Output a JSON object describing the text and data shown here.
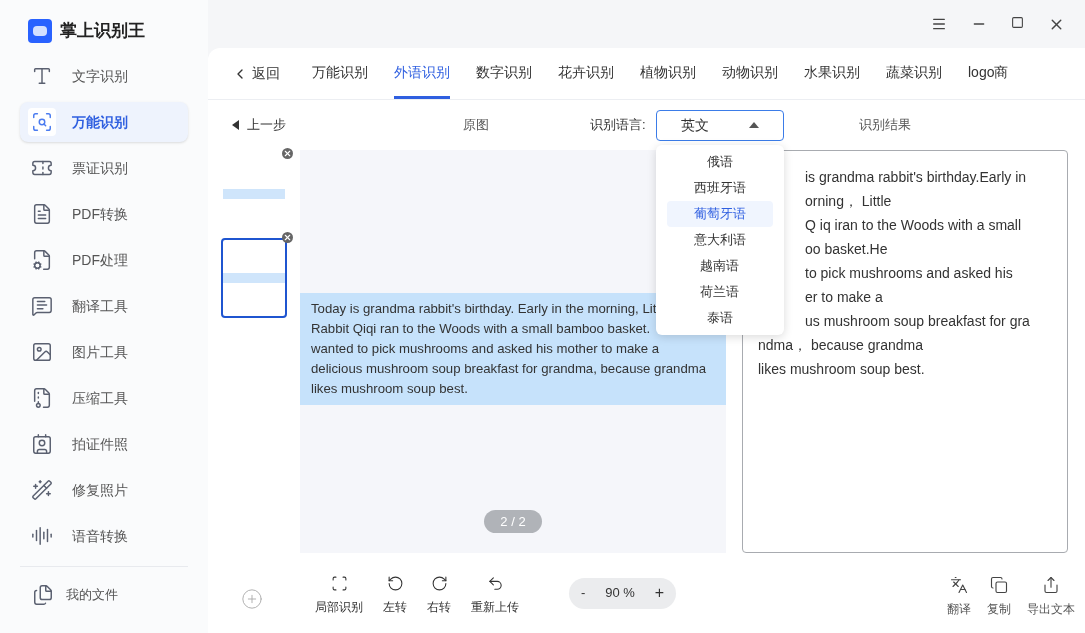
{
  "app": {
    "title": "掌上识别王"
  },
  "sidebar": {
    "items": [
      {
        "label": "文字识别",
        "selected": false,
        "kind": "text"
      },
      {
        "label": "万能识别",
        "selected": true,
        "kind": "scan"
      },
      {
        "label": "票证识别",
        "selected": false,
        "kind": "ticket"
      },
      {
        "label": "PDF转换",
        "selected": false,
        "kind": "pdf"
      },
      {
        "label": "PDF处理",
        "selected": false,
        "kind": "pdfedit"
      },
      {
        "label": "翻译工具",
        "selected": false,
        "kind": "translate"
      },
      {
        "label": "图片工具",
        "selected": false,
        "kind": "image"
      },
      {
        "label": "压缩工具",
        "selected": false,
        "kind": "compress"
      },
      {
        "label": "拍证件照",
        "selected": false,
        "kind": "idphoto"
      },
      {
        "label": "修复照片",
        "selected": false,
        "kind": "repair"
      },
      {
        "label": "语音转换",
        "selected": false,
        "kind": "voice"
      }
    ],
    "footer": "我的文件"
  },
  "tabs": {
    "back": "返回",
    "items": [
      {
        "label": "万能识别",
        "selected": false
      },
      {
        "label": "外语识别",
        "selected": true
      },
      {
        "label": "数字识别",
        "selected": false
      },
      {
        "label": "花卉识别",
        "selected": false
      },
      {
        "label": "植物识别",
        "selected": false
      },
      {
        "label": "动物识别",
        "selected": false
      },
      {
        "label": "水果识别",
        "selected": false
      },
      {
        "label": "蔬菜识别",
        "selected": false
      },
      {
        "label": "logo商",
        "selected": false
      }
    ]
  },
  "toolbar": {
    "prev_step": "上一步",
    "original_label": "原图",
    "language_label": "识别语言:",
    "language_value": "英文",
    "result_label": "识别结果"
  },
  "language_menu": {
    "expanded": true,
    "items": [
      {
        "label": "俄语",
        "selected": false
      },
      {
        "label": "西班牙语",
        "selected": false
      },
      {
        "label": "葡萄牙语",
        "selected": true
      },
      {
        "label": "意大利语",
        "selected": false
      },
      {
        "label": "越南语",
        "selected": false
      },
      {
        "label": "荷兰语",
        "selected": false
      },
      {
        "label": "泰语",
        "selected": false
      }
    ]
  },
  "thumbnails": [
    {
      "selected": false
    },
    {
      "selected": true
    }
  ],
  "image": {
    "lines": [
      "Today is grandma rabbit's birthday. Early in the morning, Lit",
      "Rabbit Qiqi ran to the Woods with a small bamboo basket.",
      "wanted to pick mushrooms and asked his mother to make a",
      "delicious mushroom soup breakfast for grandma, because grandma",
      "likes mushroom soup best."
    ],
    "page": "2 / 2"
  },
  "result": {
    "partly_hidden_lines": [
      "is grandma rabbit's birthday.Early in",
      "orning，  Little",
      "Q iq iran to the Woods with a small",
      "oo basket.He",
      "to pick mushrooms and asked his",
      "er to make a",
      "us mushroom soup breakfast for gra"
    ],
    "lines": [
      "ndma，  because grandma",
      "likes mushroom soup best."
    ]
  },
  "bottom_tools": [
    {
      "label": "局部识别",
      "kind": "crop"
    },
    {
      "label": "左转",
      "kind": "rotate_left"
    },
    {
      "label": "右转",
      "kind": "rotate_right"
    },
    {
      "label": "重新上传",
      "kind": "reupload"
    }
  ],
  "zoom": {
    "minus": "-",
    "value": "90 %",
    "plus": "+"
  },
  "result_tools": [
    {
      "label": "翻译",
      "kind": "translate"
    },
    {
      "label": "复制",
      "kind": "copy"
    },
    {
      "label": "导出文本",
      "kind": "export"
    }
  ]
}
